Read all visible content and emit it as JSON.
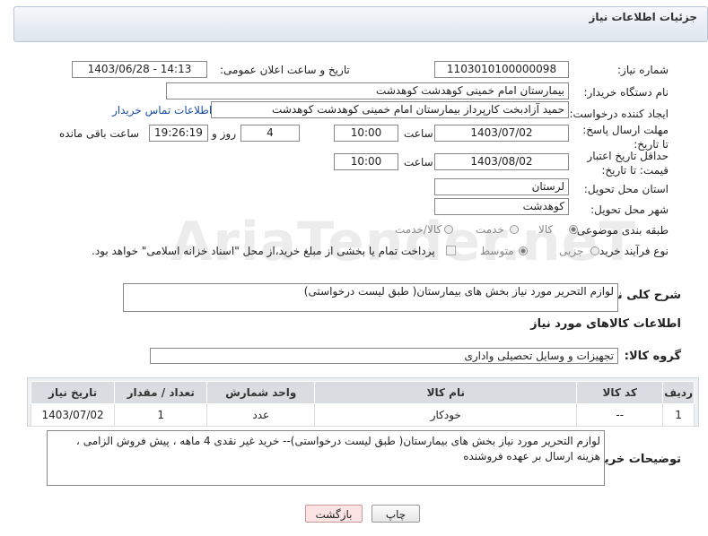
{
  "panel": {
    "title": "جزئیات اطلاعات نیاز"
  },
  "fields": {
    "need_number_label": "شماره نیاز:",
    "need_number": "1103010100000098",
    "announce_label": "تاریخ و ساعت اعلان عمومی:",
    "announce_value": "1403/06/28 - 14:13",
    "buyer_org_label": "نام دستگاه خریدار:",
    "buyer_org": "بیمارستان امام خمینی کوهدشت کوهدشت",
    "requester_label": "ایجاد کننده درخواست:",
    "requester": "حمید آزادبخت کارپرداز بیمارستان امام خمینی کوهدشت کوهدشت",
    "contact_link": "اطلاعات تماس خریدار",
    "deadline_label": "مهلت ارسال پاسخ: تا تاریخ:",
    "deadline_date": "1403/07/02",
    "time_label": "ساعت",
    "deadline_time": "10:00",
    "days_value": "4",
    "days_label": "روز و",
    "remaining_time": "19:26:19",
    "remaining_label": "ساعت باقی مانده",
    "validity_label": "حداقل تاریخ اعتبار قیمت: تا تاریخ:",
    "validity_date": "1403/08/02",
    "validity_time": "10:00",
    "province_label": "استان محل تحویل:",
    "province": "لرستان",
    "city_label": "شهر محل تحویل:",
    "city": "کوهدشت",
    "category_label": "طبقه بندی موضوعی:",
    "category_options": [
      "کالا",
      "خدمت",
      "کالا/خدمت"
    ],
    "process_label": "نوع فرآیند خرید :",
    "process_options": [
      "جزیی",
      "متوسط"
    ],
    "payment_note": "پرداخت تمام یا بخشی از مبلغ خرید،از محل \"اسناد خزانه اسلامی\" خواهد بود.",
    "description_label": "شرح کلی نیاز:",
    "description": "لوازم التحریر مورد نیاز بخش های بیمارستان( طبق لیست درخواستی)",
    "goods_info_title": "اطلاعات کالاهای مورد نیاز",
    "goods_group_label": "گروه کالا:",
    "goods_group": "تجهیزات و وسایل تحصیلی واداری"
  },
  "table": {
    "headers": [
      "ردیف",
      "کد کالا",
      "نام کالا",
      "واحد شمارش",
      "تعداد / مقدار",
      "تاریخ نیاز"
    ],
    "rows": [
      [
        "1",
        "--",
        "خودکار",
        "عدد",
        "1",
        "1403/07/02"
      ]
    ]
  },
  "buyer_notes": {
    "label": "توضیحات خریدار:",
    "text": "لوازم التحریر مورد نیاز بخش های بیمارستان( طبق لیست درخواستی)-- خرید غیر نقدی 4 ماهه ، پیش فروش الزامی ، هزینه ارسال بر عهده فروشنده"
  },
  "buttons": {
    "print": "چاپ",
    "back": "بازگشت"
  },
  "watermark": "AriaTender.neT"
}
